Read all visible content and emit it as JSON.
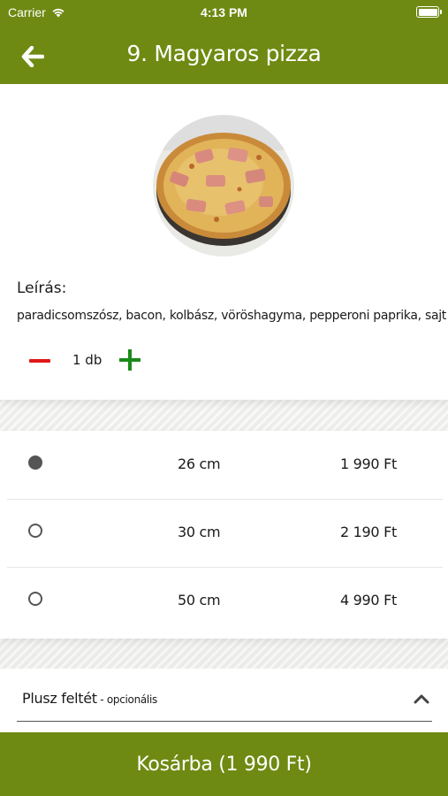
{
  "status_bar": {
    "carrier": "Carrier",
    "time": "4:13 PM"
  },
  "header": {
    "title": "9. Magyaros pizza",
    "back_icon": "arrow-left-icon",
    "color": "#6e8a12"
  },
  "product": {
    "image_alt": "pizza",
    "description_heading": "Leírás:",
    "description": "paradicsomszósz, bacon, kolbász, vöröshagyma, pepperoni paprika, sajt"
  },
  "quantity": {
    "value": "1 db",
    "minus_icon": "minus-icon",
    "plus_icon": "plus-icon",
    "minus_color": "#e01818",
    "plus_color": "#1a8a1a"
  },
  "sizes": [
    {
      "size": "26 cm",
      "price": "1 990 Ft",
      "selected": true
    },
    {
      "size": "30 cm",
      "price": "2 190 Ft",
      "selected": false
    },
    {
      "size": "50 cm",
      "price": "4 990 Ft",
      "selected": false
    }
  ],
  "extras": {
    "label": "Plusz feltét",
    "optional": " - opcionális",
    "chevron_icon": "chevron-up-icon"
  },
  "footer": {
    "add_to_cart": "Kosárba (1 990 Ft)"
  }
}
